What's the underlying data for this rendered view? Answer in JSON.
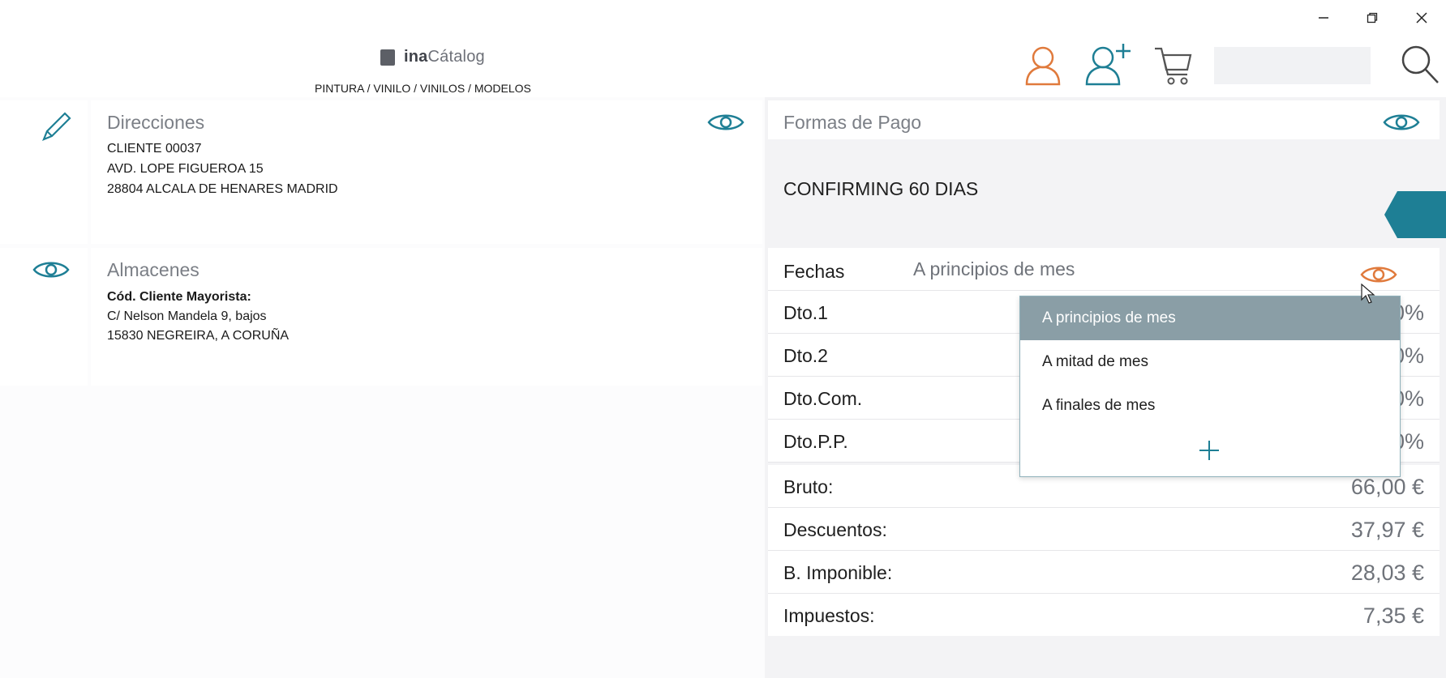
{
  "header": {
    "logo_prefix": "ina",
    "logo_suffix": "Cátalog",
    "breadcrumb": "PINTURA / VINILO / VINILOS / MODELOS",
    "icons": [
      "user-icon",
      "add-user-icon",
      "cart-icon",
      "search-icon"
    ],
    "search_value": ""
  },
  "window_controls": [
    "minimize-icon",
    "restore-icon",
    "close-icon"
  ],
  "direcciones": {
    "title": "Direcciones",
    "lines": [
      "CLIENTE 00037",
      "AVD. LOPE FIGUEROA 15",
      "28804 ALCALA DE HENARES MADRID"
    ]
  },
  "almacenes": {
    "title": "Almacenes",
    "bold_line": "Cód. Cliente Mayorista:",
    "lines": [
      "C/ Nelson Mandela 9, bajos",
      "15830 NEGREIRA, A CORUÑA"
    ]
  },
  "formas_pago": {
    "title": "Formas de Pago",
    "value": "CONFIRMING 60 DIAS"
  },
  "fechas": {
    "label": "Fechas",
    "value": "A principios de mes"
  },
  "descuentos_rows": [
    {
      "label": "Dto.1",
      "value": "0%"
    },
    {
      "label": "Dto.2",
      "value": "0%"
    },
    {
      "label": "Dto.Com.",
      "value": "0%"
    },
    {
      "label": "Dto.P.P.",
      "value": "0%"
    }
  ],
  "totals": [
    {
      "label": "Bruto:",
      "value": "66,00 €"
    },
    {
      "label": "Descuentos:",
      "value": "37,97 €"
    },
    {
      "label": "B. Imponible:",
      "value": "28,03 €"
    },
    {
      "label": "Impuestos:",
      "value": "7,35 €"
    }
  ],
  "dropdown": {
    "options": [
      "A principios de mes",
      "A mitad de mes",
      "A finales de mes"
    ],
    "selected_index": 0
  },
  "colors": {
    "teal": "#1e7f95",
    "orange": "#e07a3c",
    "dropdown_selected": "#8a9ea6"
  }
}
